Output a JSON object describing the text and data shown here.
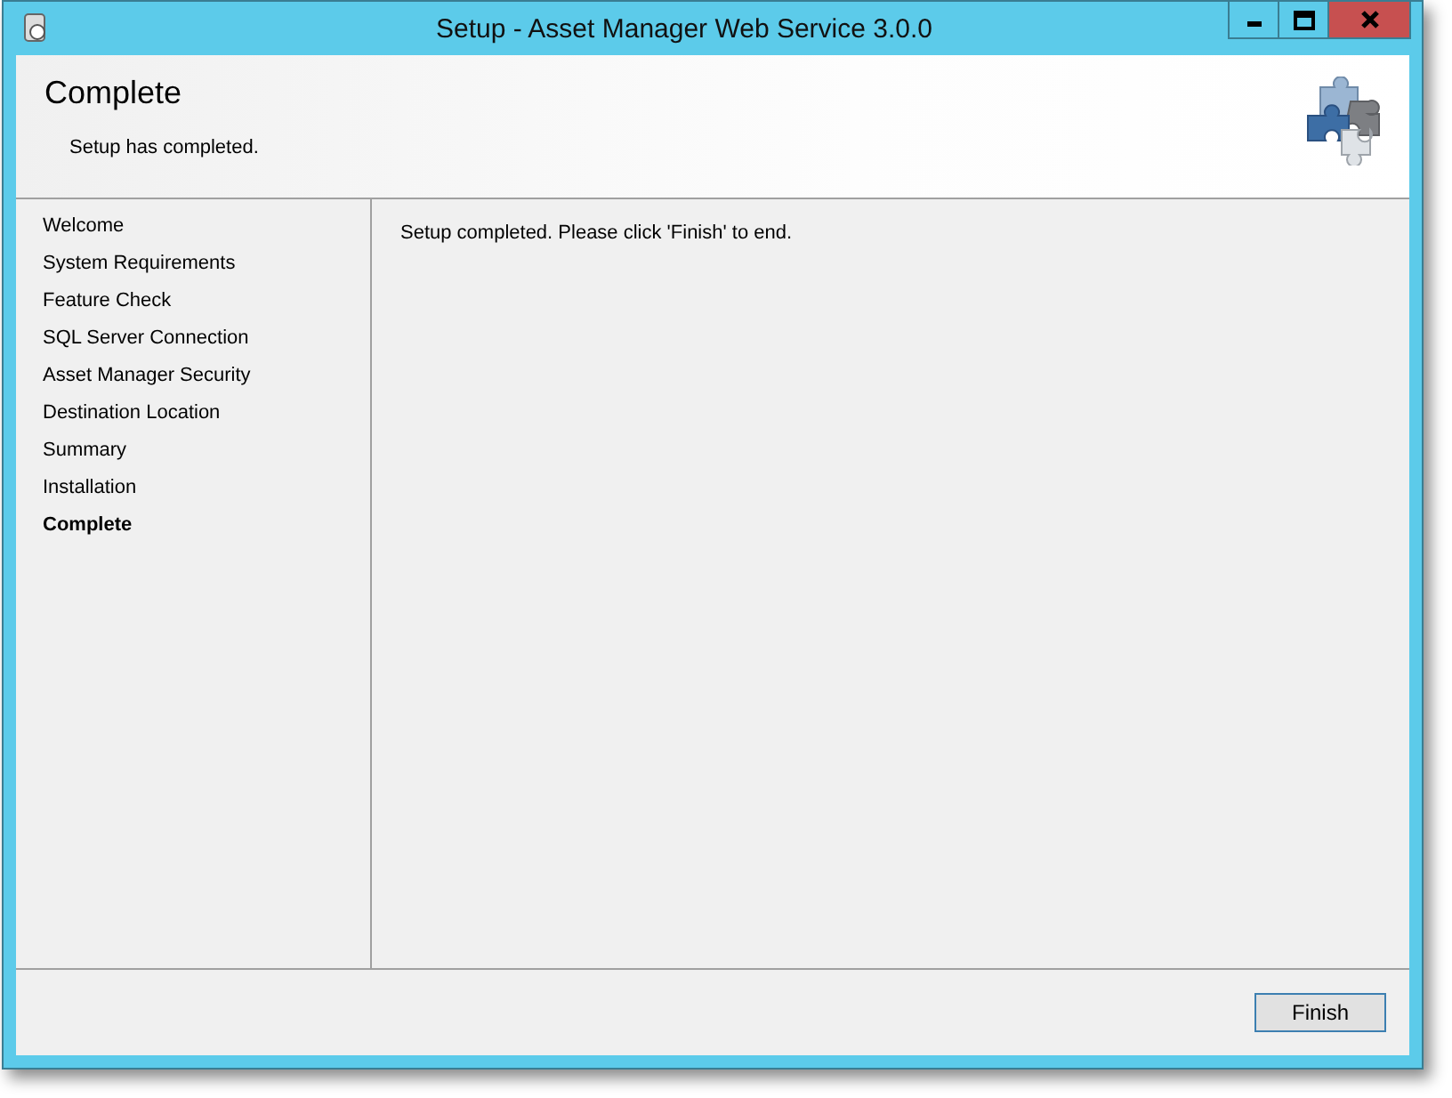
{
  "window": {
    "title": "Setup - Asset Manager Web Service 3.0.0"
  },
  "header": {
    "title": "Complete",
    "subtitle": "Setup has completed."
  },
  "steps": [
    {
      "label": "Welcome",
      "selected": false
    },
    {
      "label": "System Requirements",
      "selected": false
    },
    {
      "label": "Feature Check",
      "selected": false
    },
    {
      "label": "SQL Server Connection",
      "selected": false
    },
    {
      "label": "Asset Manager Security",
      "selected": false
    },
    {
      "label": "Destination Location",
      "selected": false
    },
    {
      "label": "Summary",
      "selected": false
    },
    {
      "label": "Installation",
      "selected": false
    },
    {
      "label": "Complete",
      "selected": true
    }
  ],
  "message": "Setup completed. Please click 'Finish' to end.",
  "buttons": [
    "Finish"
  ]
}
